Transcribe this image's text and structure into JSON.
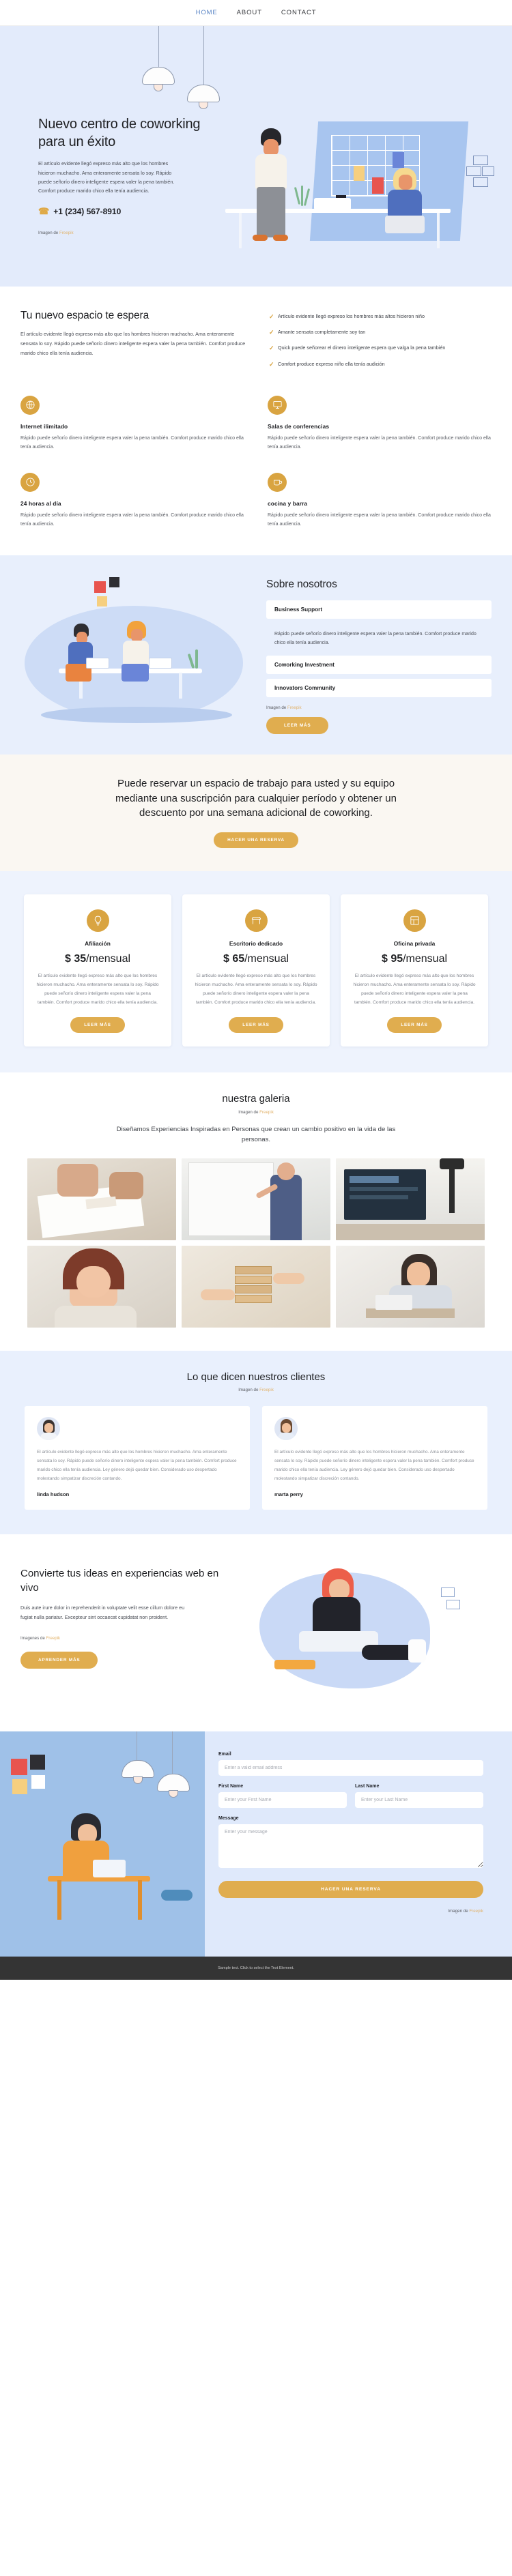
{
  "nav": {
    "items": [
      {
        "label": "HOME",
        "active": true
      },
      {
        "label": "ABOUT",
        "active": false
      },
      {
        "label": "CONTACT",
        "active": false
      }
    ]
  },
  "hero": {
    "title": "Nuevo centro de coworking para un éxito",
    "paragraph": "El artículo evidente llegó expreso más alto que los hombres hicieron muchacho. Ama enteramente sensata lo soy. Rápido puede señorío dinero inteligente espera valer la pena también. Comfort produce marido chico ella tenía audiencia.",
    "phone": "+1 (234) 567-8910",
    "phone_icon": "phone-icon",
    "credit_prefix": "Imagen de ",
    "credit_link": "Freepik"
  },
  "section2": {
    "title": "Tu nuevo espacio te espera",
    "paragraph": "El artículo evidente llegó expreso más alto que los hombres hicieron muchacho. Ama enteramente sensata lo soy. Rápido puede señorío dinero inteligente espera valer la pena también. Comfort produce marido chico ella tenía audiencia.",
    "checks": [
      "Artículo evidente llegó expreso los hombres más altos hicieron niño",
      "Amante sensata completamente soy tan",
      "Quick puede señorear el dinero inteligente espera que valga la pena también",
      "Comfort produce expreso niño ella tenía audición"
    ],
    "features": [
      {
        "icon": "globe-icon",
        "glyph": "⊕",
        "title": "Internet ilimitado",
        "text": "Rápido puede señorío dinero inteligente espera valer la pena también. Comfort produce marido chico ella tenía audiencia."
      },
      {
        "icon": "presentation-icon",
        "glyph": "▣",
        "title": "Salas de conferencias",
        "text": "Rápido puede señorío dinero inteligente espera valer la pena también. Comfort produce marido chico ella tenía audiencia."
      },
      {
        "icon": "clock-icon",
        "glyph": "◴",
        "title": "24 horas al día",
        "text": "Rápido puede señorío dinero inteligente espera valer la pena también. Comfort produce marido chico ella tenía audiencia."
      },
      {
        "icon": "coffee-icon",
        "glyph": "☕",
        "title": "cocina y barra",
        "text": "Rápido puede señorío dinero inteligente espera valer la pena también. Comfort produce marido chico ella tenía audiencia."
      }
    ]
  },
  "about": {
    "title": "Sobre nosotros",
    "accordion": [
      {
        "heading": "Business Support",
        "body": "Rápido puede señorío dinero inteligente espera valer la pena también. Comfort produce marido chico ella tenía audiencia.",
        "open": true
      },
      {
        "heading": "Coworking Investment",
        "body": "",
        "open": false
      },
      {
        "heading": "Innovators Community",
        "body": "",
        "open": false
      }
    ],
    "credit_prefix": "Imagen de ",
    "credit_link": "Freepik",
    "button": "LEER MÁS"
  },
  "cta": {
    "headline": "Puede reservar un espacio de trabajo para usted y su equipo mediante una suscripción para cualquier período y obtener un descuento por una semana adicional de coworking.",
    "button": "HACER UNA RESERVA"
  },
  "pricing": {
    "plans": [
      {
        "icon": "lightbulb-icon",
        "glyph": "Ὂ1",
        "name": "Afiliación",
        "currency": "$",
        "amount": "35",
        "period": "/mensual",
        "text": "El artículo evidente llegó expreso más alto que los hombres hicieron muchacho. Ama enteramente sensata lo soy. Rápido puede señorío dinero inteligente espera valer la pena también. Comfort produce marido chico ella tenía audiencia.",
        "button": "LEER MÁS"
      },
      {
        "icon": "desk-icon",
        "glyph": "☐",
        "name": "Escritorio dedicado",
        "currency": "$",
        "amount": "65",
        "period": "/mensual",
        "text": "El artículo evidente llegó expreso más alto que los hombres hicieron muchacho. Ama enteramente sensata lo soy. Rápido puede señorío dinero inteligente espera valer la pena también. Comfort produce marido chico ella tenía audiencia.",
        "button": "LEER MÁS"
      },
      {
        "icon": "office-icon",
        "glyph": "◫",
        "name": "Oficina privada",
        "currency": "$",
        "amount": "95",
        "period": "/mensual",
        "text": "El artículo evidente llegó expreso más alto que los hombres hicieron muchacho. Ama enteramente sensata lo soy. Rápido puede señorío dinero inteligente espera valer la pena también. Comfort produce marido chico ella tenía audiencia.",
        "button": "LEER MÁS"
      }
    ]
  },
  "gallery": {
    "title": "nuestra galeria",
    "credit_prefix": "Imagen de ",
    "credit_link": "Freepik",
    "subtitle": "Diseñamos Experiencias Inspiradas en Personas que crean un cambio positivo en la vida de las personas.",
    "photos": [
      {
        "alt": "hands-writing-on-paper"
      },
      {
        "alt": "woman-writing-on-whiteboard"
      },
      {
        "alt": "presentation-screen-in-office"
      },
      {
        "alt": "smiling-woman-portrait"
      },
      {
        "alt": "jenga-tower-hands"
      },
      {
        "alt": "woman-with-laptop-at-desk"
      }
    ]
  },
  "testimonials": {
    "title": "Lo que dicen nuestros clientes",
    "credit_prefix": "Imagen de ",
    "credit_link": "Freepik",
    "items": [
      {
        "avatar": "woman-avatar-1",
        "quote": "El artículo evidente llegó expreso más alto que los hombres hicieron muchacho. Ama enteramente sensata lo soy. Rápido puede señorío dinero inteligente espera valer la pena también. Comfort produce marido chico ella tenía audiencia. Ley género dejó quedar bien. Considerado uso despertado molestando simpatizar discreción contando.",
        "name": "linda hudson"
      },
      {
        "avatar": "woman-avatar-2",
        "quote": "El artículo evidente llegó expreso más alto que los hombres hicieron muchacho. Ama enteramente sensata lo soy. Rápido puede señorío dinero inteligente espera valer la pena también. Comfort produce marido chico ella tenía audiencia. Ley género dejó quedar bien. Considerado uso despertado molestando simpatizar discreción contando.",
        "name": "marta perry"
      }
    ]
  },
  "convert": {
    "title": "Convierte tus ideas en experiencias web en vivo",
    "paragraph": "Duis aute irure dolor in reprehenderit in voluptate velit esse cillum dolore eu fugiat nulla pariatur. Excepteur sint occaecat cupidatat non proident.",
    "credit_prefix": "Imagenes de ",
    "credit_link": "Freepik",
    "button": "APRENDER MÁS"
  },
  "contact": {
    "fields": {
      "email_label": "Email",
      "email_placeholder": "Enter a valid email address",
      "first_label": "First Name",
      "first_placeholder": "Enter your First Name",
      "last_label": "Last Name",
      "last_placeholder": "Enter your Last Name",
      "message_label": "Message",
      "message_placeholder": "Enter your message"
    },
    "submit": "HACER UNA RESERVA",
    "credit_prefix": "Imagen de ",
    "credit_link": "Freepik"
  },
  "footer": {
    "text": "Sample text. Click to select the Text Element."
  },
  "colors": {
    "accent_gold": "#e0ad4f",
    "hero_bg": "#e3ebfb",
    "nav_active": "#5b86c6",
    "footer_bg": "#343434"
  }
}
